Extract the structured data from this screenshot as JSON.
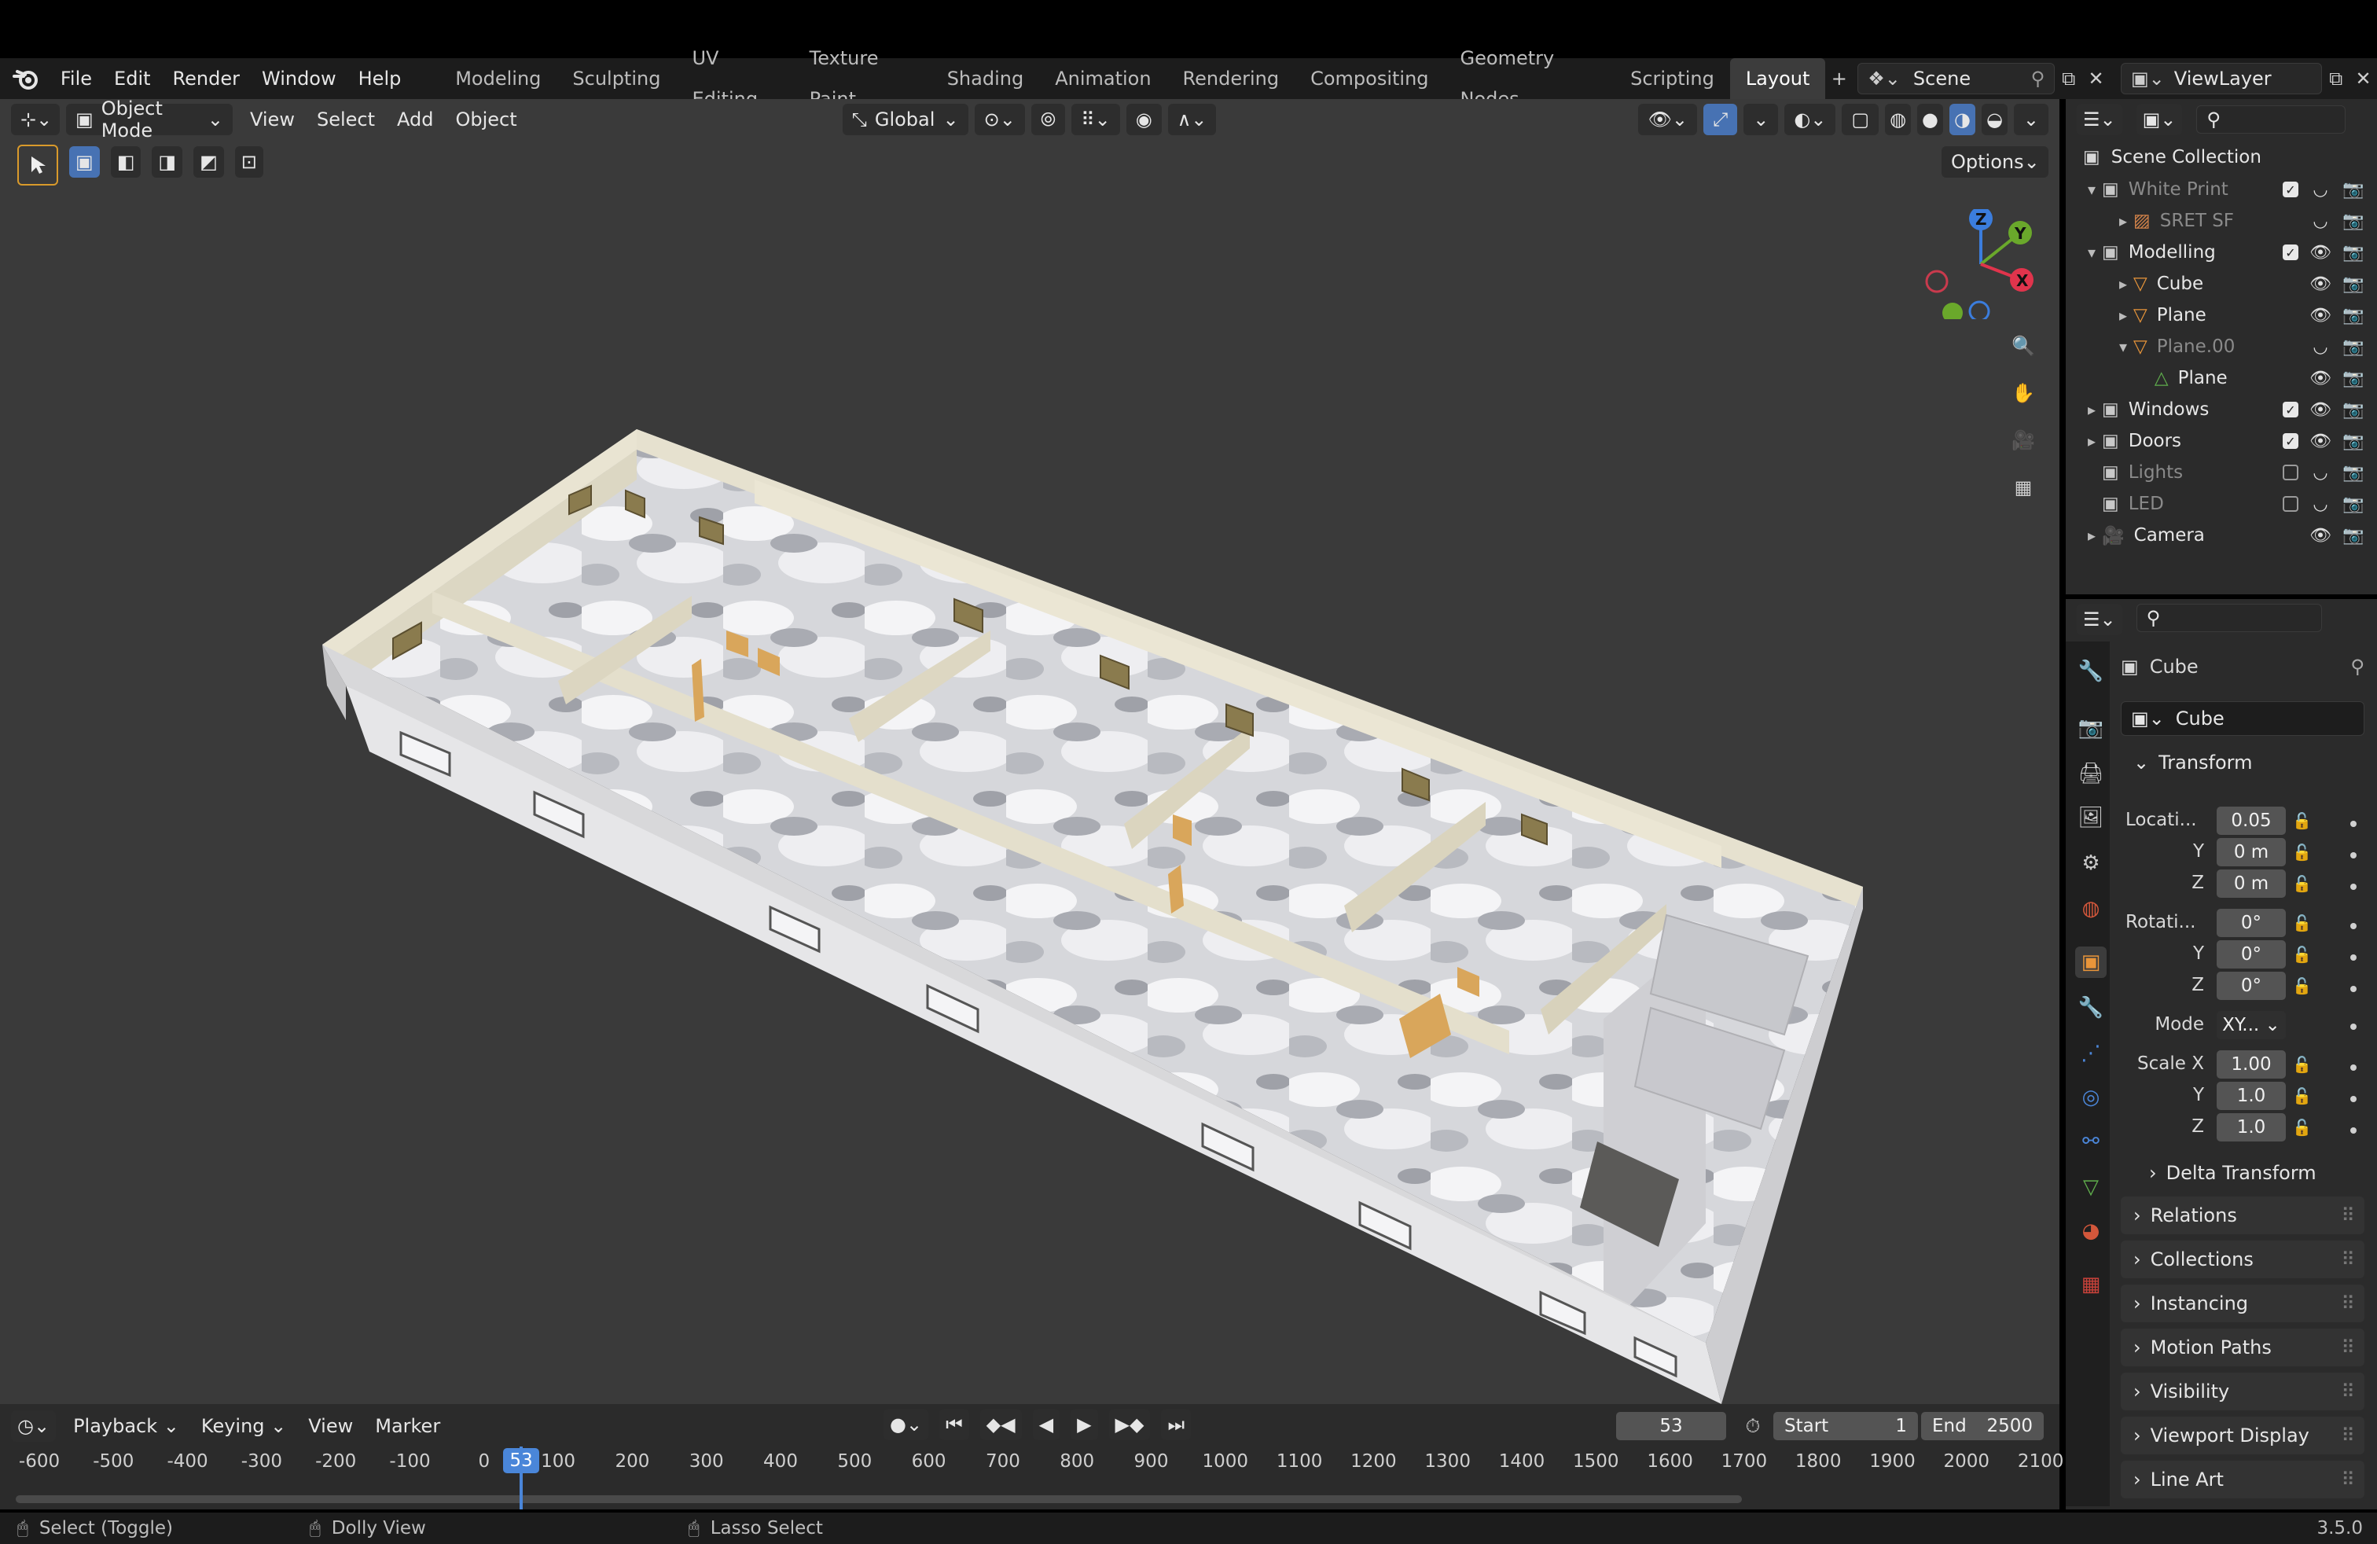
{
  "topbar": {
    "menu": [
      "File",
      "Edit",
      "Render",
      "Window",
      "Help"
    ],
    "workspaces": [
      "Modeling",
      "Sculpting",
      "UV Editing",
      "Texture Paint",
      "Shading",
      "Animation",
      "Rendering",
      "Compositing",
      "Geometry Nodes",
      "Scripting",
      "Layout"
    ],
    "active_workspace": "Layout",
    "scene": "Scene",
    "view_layer": "ViewLayer"
  },
  "viewport": {
    "mode": "Object Mode",
    "menus": [
      "View",
      "Select",
      "Add",
      "Object"
    ],
    "orientation": "Global",
    "options_label": "Options",
    "gizmo": {
      "x": "X",
      "y": "Y",
      "z": "Z"
    }
  },
  "outliner": {
    "root": "Scene Collection",
    "items": [
      {
        "label": "White Print",
        "dim": true,
        "level": 1,
        "expanded": true,
        "type": "collection",
        "checkbox": true
      },
      {
        "label": "SRET SF",
        "dim": true,
        "level": 2,
        "expanded": false,
        "type": "image",
        "checkbox": null
      },
      {
        "label": "Modelling",
        "dim": false,
        "level": 1,
        "expanded": true,
        "type": "collection",
        "checkbox": true
      },
      {
        "label": "Cube",
        "dim": false,
        "level": 2,
        "expanded": false,
        "type": "mesh",
        "checkbox": null
      },
      {
        "label": "Plane",
        "dim": false,
        "level": 2,
        "expanded": false,
        "type": "mesh",
        "checkbox": null
      },
      {
        "label": "Plane.00",
        "dim": true,
        "level": 2,
        "expanded": true,
        "type": "mesh",
        "checkbox": null
      },
      {
        "label": "Plane",
        "dim": false,
        "level": 3,
        "expanded": null,
        "type": "meshdata",
        "checkbox": null
      },
      {
        "label": "Windows",
        "dim": false,
        "level": 1,
        "expanded": false,
        "type": "collection",
        "checkbox": true
      },
      {
        "label": "Doors",
        "dim": false,
        "level": 1,
        "expanded": false,
        "type": "collection",
        "checkbox": true
      },
      {
        "label": "Lights",
        "dim": true,
        "level": 1,
        "expanded": null,
        "type": "collection",
        "checkbox": false
      },
      {
        "label": "LED",
        "dim": true,
        "level": 1,
        "expanded": null,
        "type": "collection",
        "checkbox": false
      },
      {
        "label": "Camera",
        "dim": false,
        "level": 1,
        "expanded": false,
        "type": "camera",
        "checkbox": null
      }
    ]
  },
  "properties": {
    "object_name": "Cube",
    "data_name": "Cube",
    "transform_label": "Transform",
    "location_label": "Locati...",
    "location": [
      "0.05",
      "0 m",
      "0 m"
    ],
    "rotation_label": "Rotati...",
    "rotation": [
      "0°",
      "0°",
      "0°"
    ],
    "mode_label": "Mode",
    "mode_value": "XY...",
    "scale_label": "Scale X",
    "scale": [
      "1.00",
      "1.0",
      "1.0"
    ],
    "axis_labels": [
      "Y",
      "Z"
    ],
    "delta": "Delta Transform",
    "panels": [
      "Relations",
      "Collections",
      "Instancing",
      "Motion Paths",
      "Visibility",
      "Viewport Display",
      "Line Art"
    ]
  },
  "timeline": {
    "menus": [
      "Playback",
      "Keying",
      "View",
      "Marker"
    ],
    "current_frame": "53",
    "start_label": "Start",
    "start": "1",
    "end_label": "End",
    "end": "2500",
    "ticks": [
      "-600",
      "-500",
      "-400",
      "-300",
      "-200",
      "-100",
      "0",
      "100",
      "200",
      "300",
      "400",
      "500",
      "600",
      "700",
      "800",
      "900",
      "1000",
      "1100",
      "1200",
      "1300",
      "1400",
      "1500",
      "1600",
      "1700",
      "1800",
      "1900",
      "2000",
      "2100"
    ]
  },
  "statusbar": {
    "select": "Select (Toggle)",
    "dolly": "Dolly View",
    "lasso": "Lasso Select",
    "version": "3.5.0"
  }
}
